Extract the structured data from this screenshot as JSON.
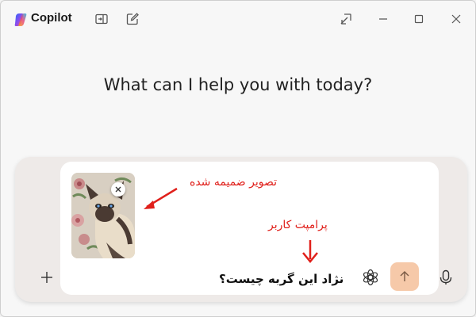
{
  "app": {
    "title": "Copilot"
  },
  "titlebar_icons": [
    "side-panel-icon",
    "new-chat-icon",
    "pin-to-corner-icon",
    "minimize-icon",
    "maximize-icon",
    "close-icon"
  ],
  "main": {
    "greeting": "What can I help you with today?"
  },
  "composer": {
    "prompt_text": "نژاد این گربه چیست؟",
    "attachment": {
      "icon": "cat-photo-thumbnail"
    },
    "buttons": {
      "add": "plus-icon",
      "model": "openai-icon",
      "send": "arrow-up-icon",
      "mic": "microphone-icon"
    }
  },
  "annotations": {
    "attachment_label": "تصویر ضمیمه شده",
    "prompt_label": "پرامپت کاربر"
  },
  "colors": {
    "accent_send": "#f6c9a9",
    "annotation_red": "#e0201b"
  }
}
